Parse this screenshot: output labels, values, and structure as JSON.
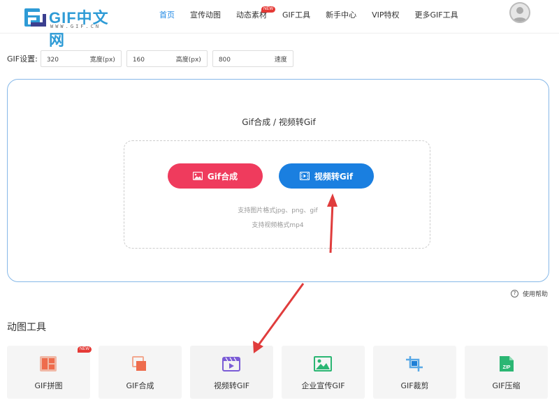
{
  "header": {
    "logo_text": "GIF中文网",
    "logo_sub": "WWW.GIF.CN",
    "nav": [
      {
        "label": "首页",
        "active": true
      },
      {
        "label": "宣传动图",
        "active": false
      },
      {
        "label": "动态素材",
        "active": false,
        "badge": "NEW"
      },
      {
        "label": "GIF工具",
        "active": false
      },
      {
        "label": "新手中心",
        "active": false
      },
      {
        "label": "VIP特权",
        "active": false
      },
      {
        "label": "更多GIF工具",
        "active": false
      }
    ],
    "avatar_icon": "user-avatar-icon"
  },
  "settings": {
    "label": "GIF设置:",
    "width": {
      "value": "320",
      "unit": "宽度(px)"
    },
    "height": {
      "value": "160",
      "unit": "高度(px)"
    },
    "speed": {
      "value": "800",
      "unit": "速度"
    }
  },
  "panel": {
    "title": "Gif合成 / 视频转Gif",
    "btn_gif": "Gif合成",
    "btn_video": "视频转Gif",
    "hint_image": "支持图片格式jpg、png、gif",
    "hint_video": "支持视频格式mp4"
  },
  "help": {
    "label": "使用帮助"
  },
  "section_title": "动图工具",
  "tools": [
    {
      "label": "GIF拼图",
      "icon": "grid-collage-icon",
      "badge": "NEW"
    },
    {
      "label": "GIF合成",
      "icon": "layers-merge-icon"
    },
    {
      "label": "视频转GIF",
      "icon": "video-clapper-icon"
    },
    {
      "label": "企业宣传GIF",
      "icon": "landscape-image-icon"
    },
    {
      "label": "GIF裁剪",
      "icon": "crop-icon"
    },
    {
      "label": "GIF压缩",
      "icon": "zip-file-icon"
    }
  ],
  "colors": {
    "accent_blue": "#1a7fe0",
    "accent_red": "#ef3b5d",
    "annotation_arrow": "#e03c3c"
  }
}
